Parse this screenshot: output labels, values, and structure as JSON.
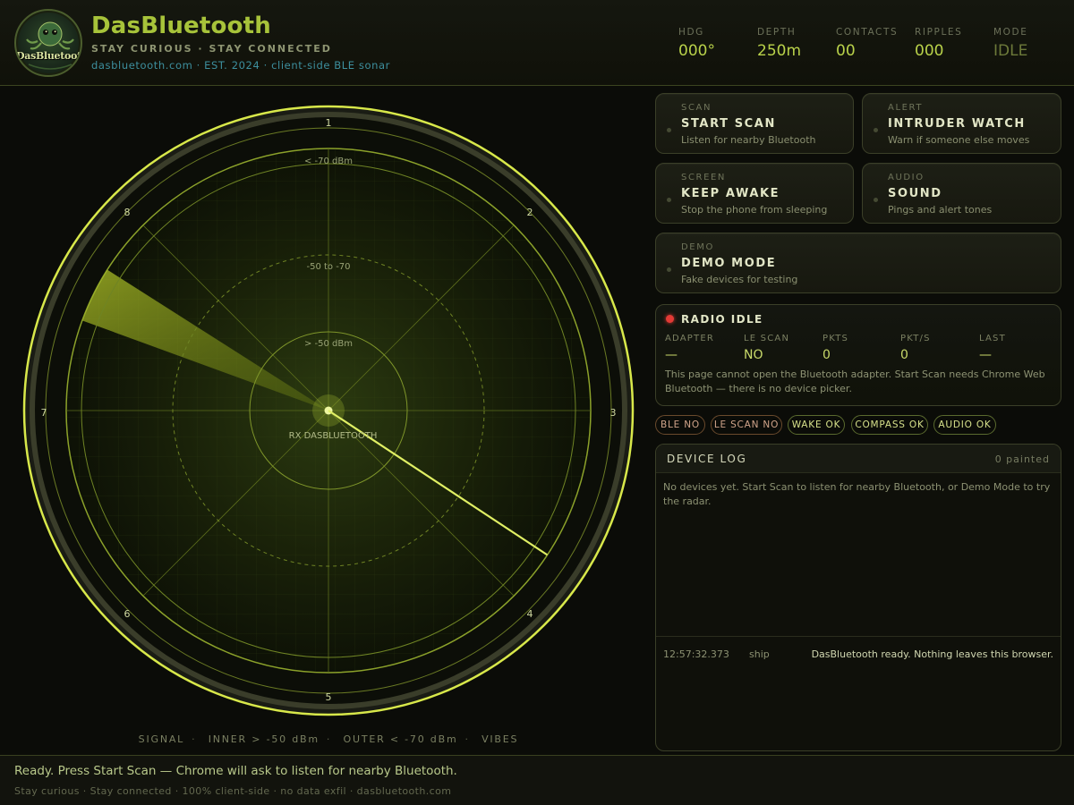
{
  "brand": {
    "logo_text": "DasBluetooth",
    "title": "DasBluetooth",
    "tagline": "STAY CURIOUS · STAY CONNECTED",
    "subtitle": "dasbluetooth.com · EST. 2024 · client-side BLE sonar"
  },
  "stats": [
    {
      "label": "HDG",
      "value": "000°"
    },
    {
      "label": "DEPTH",
      "value": "250m"
    },
    {
      "label": "CONTACTS",
      "value": "00"
    },
    {
      "label": "RIPPLES",
      "value": "000"
    },
    {
      "label": "MODE",
      "value": "IDLE"
    }
  ],
  "radar": {
    "bearing_labels": [
      "1",
      "2",
      "3",
      "4",
      "5",
      "6",
      "7",
      "8"
    ],
    "ring_labels": {
      "outer": "< -70 dBm",
      "middle": "-50 to -70",
      "inner": "> -50 dBm"
    },
    "center_label": "RX DASBLUETOOTH",
    "accent_color": "#d8e84a",
    "legend": [
      "SIGNAL",
      "INNER > -50 dBm",
      "OUTER < -70 dBm",
      "VIBES"
    ]
  },
  "controls": {
    "scan": {
      "kicker": "SCAN",
      "title": "START SCAN",
      "desc": "Listen for nearby Bluetooth"
    },
    "alert": {
      "kicker": "ALERT",
      "title": "INTRUDER WATCH",
      "desc": "Warn if someone else moves"
    },
    "screen": {
      "kicker": "SCREEN",
      "title": "KEEP AWAKE",
      "desc": "Stop the phone from sleeping"
    },
    "audio": {
      "kicker": "AUDIO",
      "title": "SOUND",
      "desc": "Pings and alert tones"
    },
    "demo": {
      "kicker": "DEMO",
      "title": "DEMO MODE",
      "desc": "Fake devices for testing"
    }
  },
  "radio": {
    "title": "RADIO IDLE",
    "status_color": "#e23a35",
    "stats": [
      {
        "label": "ADAPTER",
        "value": "—"
      },
      {
        "label": "LE SCAN",
        "value": "NO"
      },
      {
        "label": "PKTS",
        "value": "0"
      },
      {
        "label": "PKT/S",
        "value": "0"
      },
      {
        "label": "LAST",
        "value": "—"
      }
    ],
    "note": "This page cannot open the Bluetooth adapter. Start Scan needs Chrome Web Bluetooth — there is no device picker."
  },
  "chips": [
    {
      "label": "BLE NO",
      "state": "bad"
    },
    {
      "label": "LE SCAN NO",
      "state": "bad"
    },
    {
      "label": "WAKE OK",
      "state": "ok"
    },
    {
      "label": "COMPASS OK",
      "state": "ok"
    },
    {
      "label": "AUDIO OK",
      "state": "ok"
    }
  ],
  "log": {
    "title": "DEVICE LOG",
    "count": "0 painted",
    "empty": "No devices yet. Start Scan to listen for nearby Bluetooth, or Demo Mode to try the radar.",
    "entries": [
      {
        "time": "12:57:32.373",
        "source": "ship",
        "message": "DasBluetooth ready. Nothing leaves this browser."
      }
    ]
  },
  "footer": {
    "status": "Ready. Press Start Scan — Chrome will ask to listen for nearby Bluetooth.",
    "sub": "Stay curious · Stay connected · 100% client-side · no data exfil · dasbluetooth.com"
  }
}
